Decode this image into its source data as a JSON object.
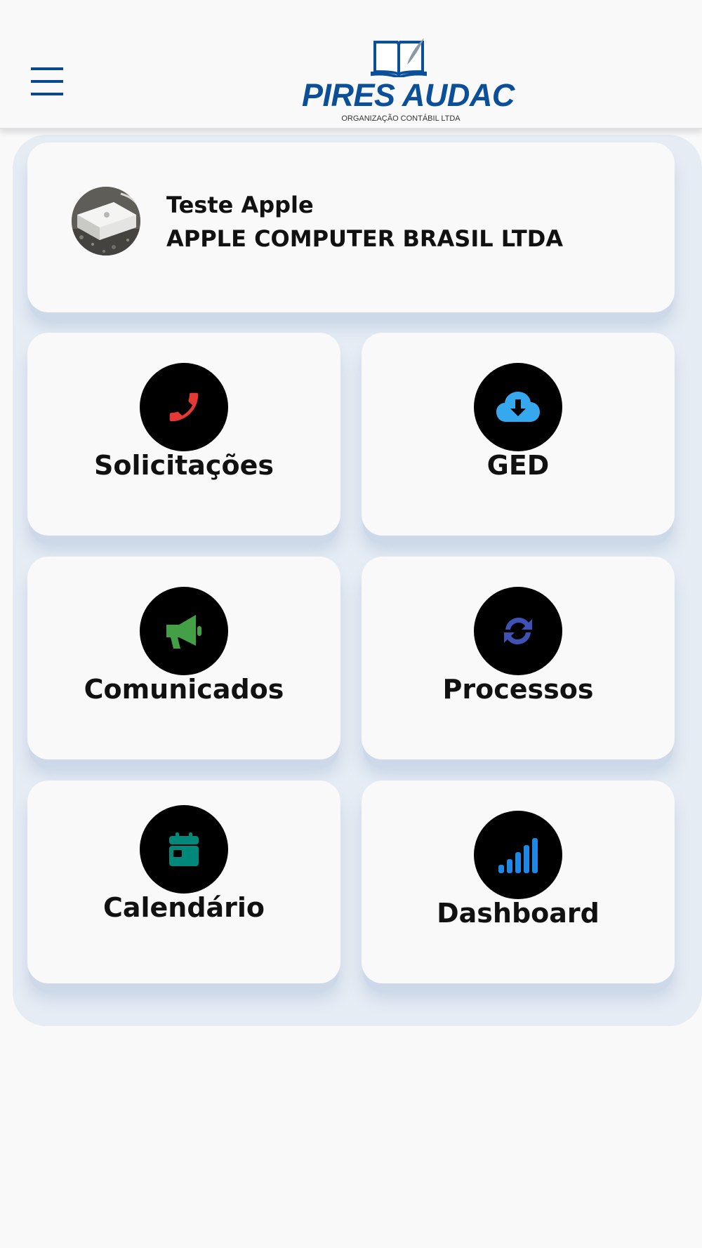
{
  "header": {
    "menu_icon": "hamburger-menu-icon",
    "logo": {
      "name": "PIRES AUDAC",
      "subtitle": "ORGANIZAÇÃO CONTÁBIL LTDA",
      "brand_color": "#0b4f98"
    }
  },
  "profile": {
    "user_name": "Teste Apple",
    "company": "APPLE COMPUTER BRASIL LTDA"
  },
  "tiles": [
    {
      "label": "Solicitações",
      "icon": "phone-icon",
      "icon_color": "#e53935"
    },
    {
      "label": "GED",
      "icon": "cloud-download-icon",
      "icon_color": "#35a8ee"
    },
    {
      "label": "Comunicados",
      "icon": "megaphone-icon",
      "icon_color": "#43a047"
    },
    {
      "label": "Processos",
      "icon": "sync-icon",
      "icon_color": "#3f51b5"
    },
    {
      "label": "Calendário",
      "icon": "calendar-icon",
      "icon_color": "#00897b"
    },
    {
      "label": "Dashboard",
      "icon": "signal-bars-icon",
      "icon_color": "#1e88e5"
    }
  ],
  "colors": {
    "background": "#f9f9fa",
    "panel": "#e5ecf4",
    "icon_circle": "#000000"
  }
}
